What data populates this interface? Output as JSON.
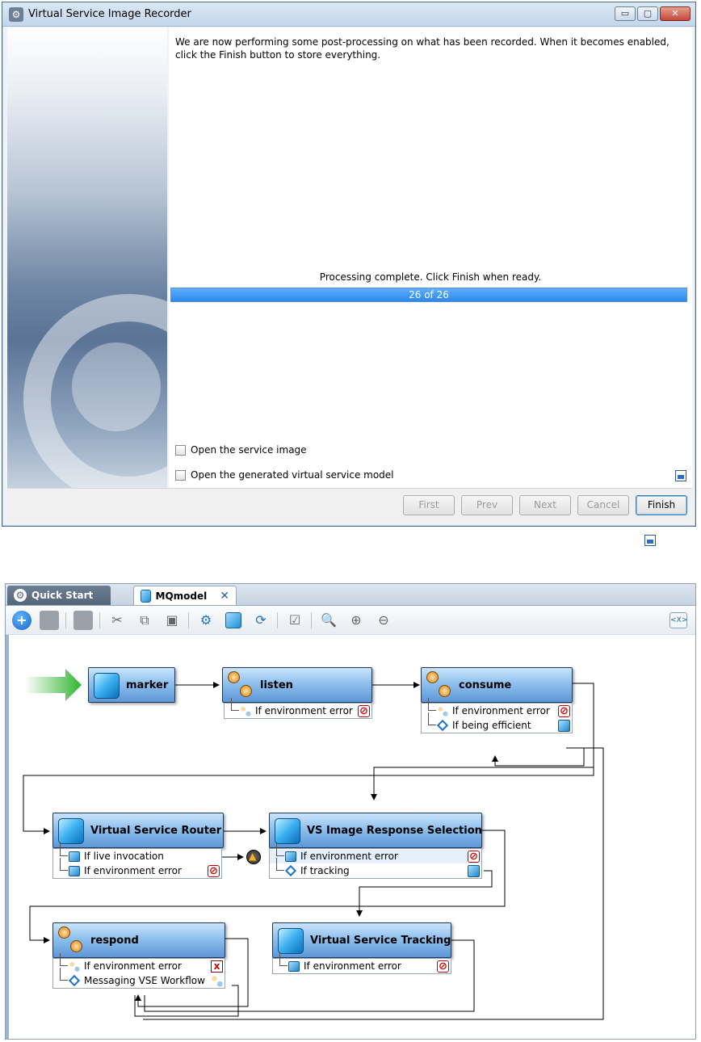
{
  "dialog": {
    "title": "Virtual Service Image Recorder",
    "info_text": "We are now performing some post-processing on what has been recorded.  When it becomes enabled, click the Finish button to store everything.",
    "status_text": "Processing complete.  Click Finish when ready.",
    "progress": {
      "text": "26 of 26",
      "value": 26,
      "max": 26
    },
    "checkboxes": [
      {
        "label": "Open the service image",
        "checked": false
      },
      {
        "label": "Open the generated virtual service model",
        "checked": false
      }
    ],
    "buttons": {
      "first": "First",
      "prev": "Prev",
      "next": "Next",
      "cancel": "Cancel",
      "finish": "Finish"
    },
    "window_controls": {
      "minimize": "▭",
      "maximize": "▢",
      "close": "✕"
    }
  },
  "editor": {
    "tabs": [
      {
        "label": "Quick Start",
        "icon": "gear-icon"
      },
      {
        "label": "MQmodel",
        "icon": "cube-icon",
        "close": "✕"
      }
    ],
    "xml_button": "<X>",
    "toolbar_glyphs": {
      "add": "+",
      "cut": "✂",
      "copy": "⧉",
      "paste": "▣",
      "settings": "⚙",
      "refresh": "⟳",
      "checklist": "☑",
      "search": "🔍",
      "zoom_in": "⊕",
      "zoom_out": "⊖"
    },
    "nodes": {
      "marker": "marker",
      "listen": "listen",
      "consume": "consume",
      "router": "Virtual Service Router",
      "selection": "VS Image Response Selection",
      "respond": "respond",
      "tracking": "Virtual Service Tracking"
    },
    "branches": {
      "listen": [
        "If environment error"
      ],
      "consume": [
        "If environment error",
        "If being efficient"
      ],
      "router": [
        "If live invocation",
        "If environment error"
      ],
      "selection": [
        "If environment error",
        "If tracking"
      ],
      "respond": [
        "If environment error",
        "Messaging VSE Workflow"
      ],
      "tracking": [
        "If environment error"
      ]
    }
  }
}
